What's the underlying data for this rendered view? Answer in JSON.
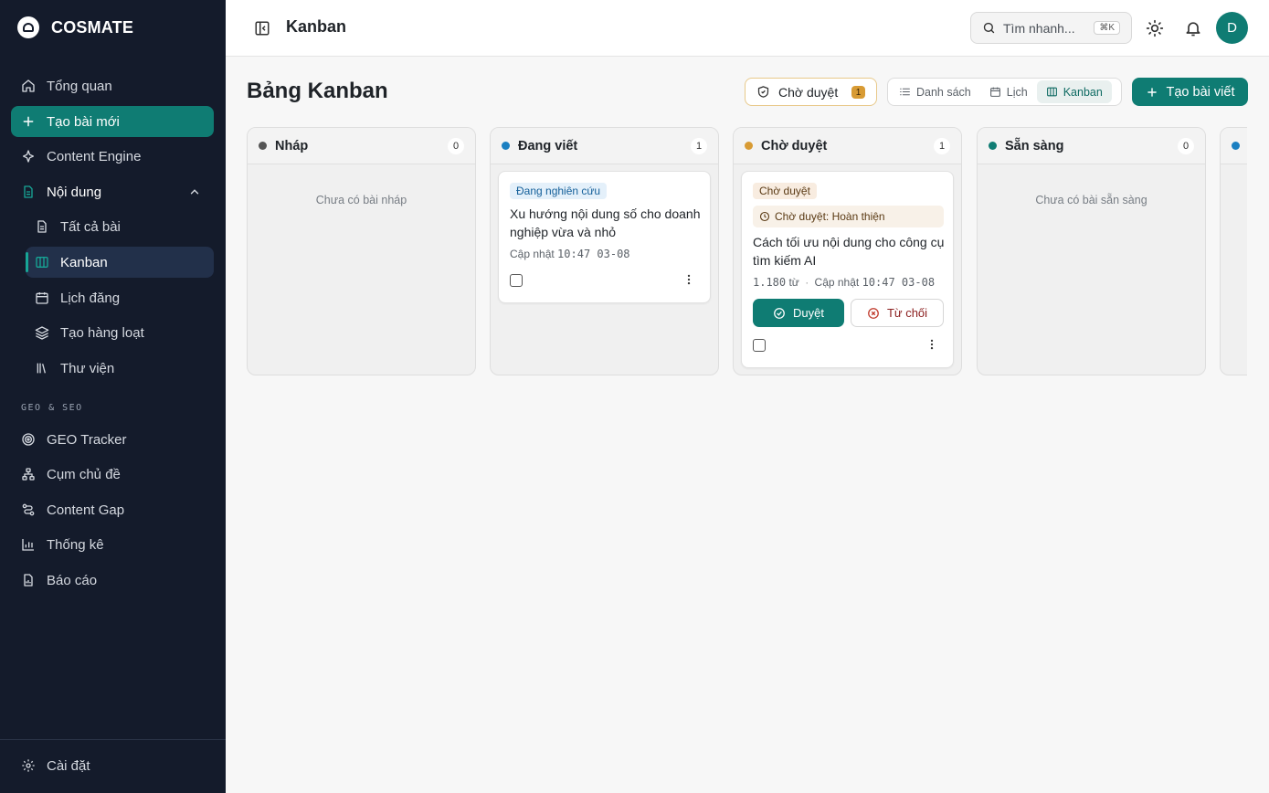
{
  "app": {
    "brand": "COSMATE"
  },
  "sidebar": {
    "items": [
      {
        "label": "Tổng quan",
        "icon": "home-icon"
      },
      {
        "label": "Tạo bài mới",
        "icon": "plus-icon"
      },
      {
        "label": "Content Engine",
        "icon": "sparkle-icon"
      },
      {
        "label": "Nội dung",
        "icon": "document-icon"
      }
    ],
    "sub_items": [
      {
        "label": "Tất cả bài",
        "icon": "file-icon"
      },
      {
        "label": "Kanban",
        "icon": "kanban-icon"
      },
      {
        "label": "Lịch đăng",
        "icon": "calendar-icon"
      },
      {
        "label": "Tạo hàng loạt",
        "icon": "layers-icon"
      },
      {
        "label": "Thư viện",
        "icon": "library-icon"
      }
    ],
    "section_label": "GEO & SEO",
    "section_items": [
      {
        "label": "GEO Tracker",
        "icon": "target-icon"
      },
      {
        "label": "Cụm chủ đề",
        "icon": "network-icon"
      },
      {
        "label": "Content Gap",
        "icon": "route-icon"
      },
      {
        "label": "Thống kê",
        "icon": "bar-chart-icon"
      },
      {
        "label": "Báo cáo",
        "icon": "report-icon"
      }
    ],
    "settings": {
      "label": "Cài đặt",
      "icon": "gear-icon"
    }
  },
  "header": {
    "title": "Kanban",
    "search_placeholder": "Tìm nhanh...",
    "search_shortcut": "⌘K",
    "avatar_initial": "D"
  },
  "toolbar": {
    "page_title": "Bảng Kanban",
    "pending_label": "Chờ duyệt",
    "pending_count": "1",
    "views": [
      "Danh sách",
      "Lịch",
      "Kanban"
    ],
    "create_label": "Tạo bài viết"
  },
  "board": {
    "columns": [
      {
        "title": "Nháp",
        "count": "0",
        "color": "#555555",
        "empty": "Chưa có bài nháp"
      },
      {
        "title": "Đang viết",
        "count": "1",
        "color": "#1a7fc1"
      },
      {
        "title": "Chờ duyệt",
        "count": "1",
        "color": "#d89b34"
      },
      {
        "title": "Sẵn sàng",
        "count": "0",
        "color": "#0f7c73",
        "empty": "Chưa có bài sẵn sàng"
      }
    ],
    "writing_card": {
      "tag": "Đang nghiên cứu",
      "title": "Xu hướng nội dung số cho doanh nghiệp vừa và nhỏ",
      "updated_prefix": "Cập nhật",
      "updated_time": "10:47 03-08"
    },
    "review_card": {
      "tag": "Chờ duyệt",
      "stage": "Chờ duyệt: Hoàn thiện",
      "title": "Cách tối ưu nội dung cho công cụ tìm kiếm AI",
      "words": "1.180",
      "words_unit": "từ",
      "separator": "·",
      "updated_prefix": "Cập nhật",
      "updated_time": "10:47 03-08",
      "approve_label": "Duyệt",
      "reject_label": "Từ chối"
    }
  },
  "colors": {
    "accent": "#0f7c73",
    "sidebar_bg": "#141b2b",
    "warning": "#d89b34"
  }
}
